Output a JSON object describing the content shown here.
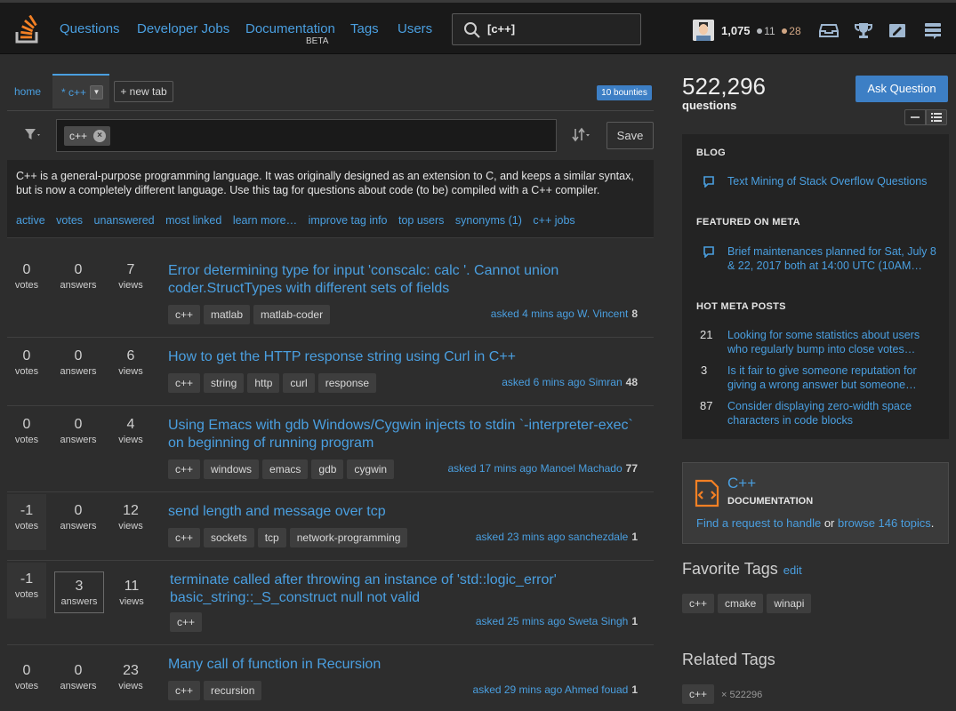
{
  "topbar": {
    "nav": [
      "Questions",
      "Developer Jobs",
      "Documentation",
      "Tags",
      "Users"
    ],
    "documentation_beta": "BETA",
    "search_value": "[c++]",
    "reputation": "1,075",
    "silver_badges": "11",
    "bronze_badges": "28",
    "icons": [
      "inbox-icon",
      "achievements-icon",
      "review-icon",
      "stackexchange-menu-icon"
    ]
  },
  "tabs": {
    "home": "home",
    "active_tab": "* c++",
    "new_tab": "+ new tab",
    "bounties": "10 bounties"
  },
  "filter": {
    "chip": "c++",
    "save": "Save"
  },
  "tag_info": {
    "description": "C++ is a general-purpose programming language. It was originally designed as an extension to C, and keeps a similar syntax, but is now a completely different language. Use this tag for questions about code (to be) compiled with a C++ compiler.",
    "links": [
      "active",
      "votes",
      "unanswered",
      "most linked",
      "learn more…",
      "improve tag info",
      "top users",
      "synonyms (1)",
      "c++ jobs"
    ]
  },
  "questions": [
    {
      "votes": "0",
      "votes_label": "votes",
      "answers": "0",
      "answers_label": "answers",
      "views": "7",
      "views_label": "views",
      "title": "Error determining type for input 'conscalc: calc '. Cannot union coder.StructTypes with different sets of fields",
      "tags": [
        "c++",
        "matlab",
        "matlab-coder"
      ],
      "asked": "asked 4 mins ago",
      "user": "W. Vincent",
      "rep": "8"
    },
    {
      "votes": "0",
      "votes_label": "votes",
      "answers": "0",
      "answers_label": "answers",
      "views": "6",
      "views_label": "views",
      "title": "How to get the HTTP response string using Curl in C++",
      "tags": [
        "c++",
        "string",
        "http",
        "curl",
        "response"
      ],
      "asked": "asked 6 mins ago",
      "user": "Simran",
      "rep": "48"
    },
    {
      "votes": "0",
      "votes_label": "votes",
      "answers": "0",
      "answers_label": "answers",
      "views": "4",
      "views_label": "views",
      "title": "Using Emacs with gdb Windows/Cygwin injects to stdin `-interpreter-exec` on beginning of running program",
      "tags": [
        "c++",
        "windows",
        "emacs",
        "gdb",
        "cygwin"
      ],
      "asked": "asked 17 mins ago",
      "user": "Manoel Machado",
      "rep": "77"
    },
    {
      "votes": "-1",
      "votes_label": "votes",
      "answers": "0",
      "answers_label": "answers",
      "views": "12",
      "views_label": "views",
      "title": "send length and message over tcp",
      "tags": [
        "c++",
        "sockets",
        "tcp",
        "network-programming"
      ],
      "asked": "asked 23 mins ago",
      "user": "sanchezdale",
      "rep": "1"
    },
    {
      "votes": "-1",
      "votes_label": "votes",
      "answers": "3",
      "answers_label": "answers",
      "views": "11",
      "views_label": "views",
      "title": "terminate called after throwing an instance of 'std::logic_error' basic_string::_S_construct null not valid",
      "tags": [
        "c++"
      ],
      "asked": "asked 25 mins ago",
      "user": "Sweta Singh",
      "rep": "1"
    },
    {
      "votes": "0",
      "votes_label": "votes",
      "answers": "0",
      "answers_label": "answers",
      "views": "23",
      "views_label": "views",
      "title": "Many call of function in Recursion",
      "tags": [
        "c++",
        "recursion"
      ],
      "asked": "asked 29 mins ago",
      "user": "Ahmed fouad",
      "rep": "1"
    }
  ],
  "sidebar": {
    "count": "522,296",
    "count_label": "questions",
    "ask": "Ask Question",
    "blog_heading": "BLOG",
    "blog_items": [
      "Text Mining of Stack Overflow Questions"
    ],
    "featured_heading": "FEATURED ON META",
    "featured_items": [
      "Brief maintenances planned for Sat, July 8 & 22, 2017 both at 14:00 UTC (10AM…"
    ],
    "hot_heading": "HOT META POSTS",
    "hot_items": [
      {
        "count": "21",
        "title": "Looking for some statistics about users who regularly bump into close votes…"
      },
      {
        "count": "3",
        "title": "Is it fair to give someone reputation for giving a wrong answer but someone…"
      },
      {
        "count": "87",
        "title": "Consider displaying zero-width space characters in code blocks"
      }
    ],
    "doc_title": "C++",
    "doc_sub": "DOCUMENTATION",
    "doc_link1": "Find a request to handle",
    "doc_or": " or ",
    "doc_link2": "browse 146 topics",
    "doc_end": ".",
    "fav_heading": "Favorite Tags",
    "fav_edit": "edit",
    "fav_tags": [
      "c++",
      "cmake",
      "winapi"
    ],
    "related_heading": "Related Tags",
    "related_tag": "c++",
    "related_count": "× 522296"
  },
  "colors": {
    "accent": "#4a9fe0",
    "brand_orange": "#f48024",
    "button_blue": "#3d7fc5",
    "silver": "#b4b8bc",
    "bronze": "#d1a684"
  }
}
